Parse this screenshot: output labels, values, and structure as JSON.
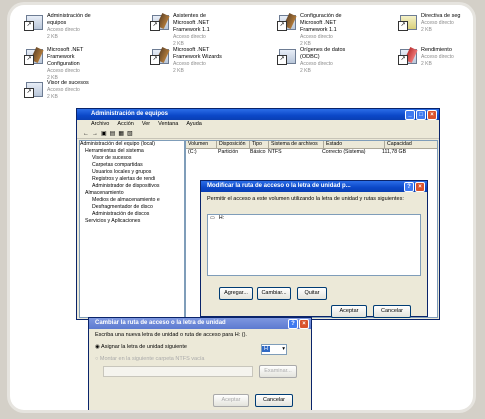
{
  "desktop_icons": [
    {
      "title": "Administración de equipos",
      "sub": "Acceso directo",
      "size": "2 KB"
    },
    {
      "title": "Asistentes de Microsoft .NET Framework 1.1",
      "sub": "Acceso directo",
      "size": "2 KB"
    },
    {
      "title": "Configuración de Microsoft .NET Framework 1.1",
      "sub": "Acceso directo",
      "size": "2 KB"
    },
    {
      "title": "Directiva de seg",
      "sub": "Acceso directo",
      "size": "2 KB"
    },
    {
      "title": "Microsoft .NET Framework Configuration",
      "sub": "Acceso directo",
      "size": "2 KB"
    },
    {
      "title": "Microsoft .NET Framework Wizards",
      "sub": "Acceso directo",
      "size": "2 KB"
    },
    {
      "title": "Orígenes de datos (ODBC)",
      "sub": "Acceso directo",
      "size": "2 KB"
    },
    {
      "title": "Rendimiento",
      "sub": "Acceso directo",
      "size": "2 KB"
    },
    {
      "title": "Visor de sucesos",
      "sub": "Acceso directo",
      "size": "2 KB"
    }
  ],
  "main_window": {
    "title": "Administración de equipos",
    "menu": [
      "Archivo",
      "Acción",
      "Ver",
      "Ventana",
      "Ayuda"
    ],
    "tree": [
      "Administración del equipo (local)",
      "Herramientas del sistema",
      "Visor de sucesos",
      "Carpetas compartidas",
      "Usuarios locales y grupos",
      "Registros y alertas de rendi",
      "Administrador de dispositivos",
      "Almacenamiento",
      "Medios de almacenamiento e",
      "Desfragmentador de disco",
      "Administración de discos",
      "Servicios y Aplicaciones"
    ],
    "columns": [
      "Volumen",
      "Disposición",
      "Tipo",
      "Sistema de archivos",
      "Estado",
      "Capacidad"
    ],
    "rows": [
      [
        "(C:)",
        "Partición",
        "Básico",
        "NTFS",
        "Correcto (Sistema)",
        "111,78 GB"
      ]
    ]
  },
  "modify_dialog": {
    "title": "Modificar la ruta de acceso o la letra de unidad p...",
    "text": "Permitir el acceso a este volumen utilizando la letra de unidad y rutas siguientes:",
    "list_item": "H:",
    "buttons": {
      "add": "Agregar...",
      "change": "Cambiar...",
      "remove": "Quitar",
      "accept": "Aceptar",
      "cancel": "Cancelar"
    }
  },
  "change_dialog": {
    "title": "Cambiar la ruta de acceso o la letra de unidad",
    "prompt": "Escriba una nueva letra de unidad o ruta de acceso para H: ().",
    "radio1": "Asignar la letra de unidad siguiente",
    "drive_letter": "H",
    "radio2": "Montar en la siguiente carpeta NTFS vacía",
    "browse": "Examinar...",
    "accept": "Aceptar",
    "cancel": "Cancelar"
  }
}
